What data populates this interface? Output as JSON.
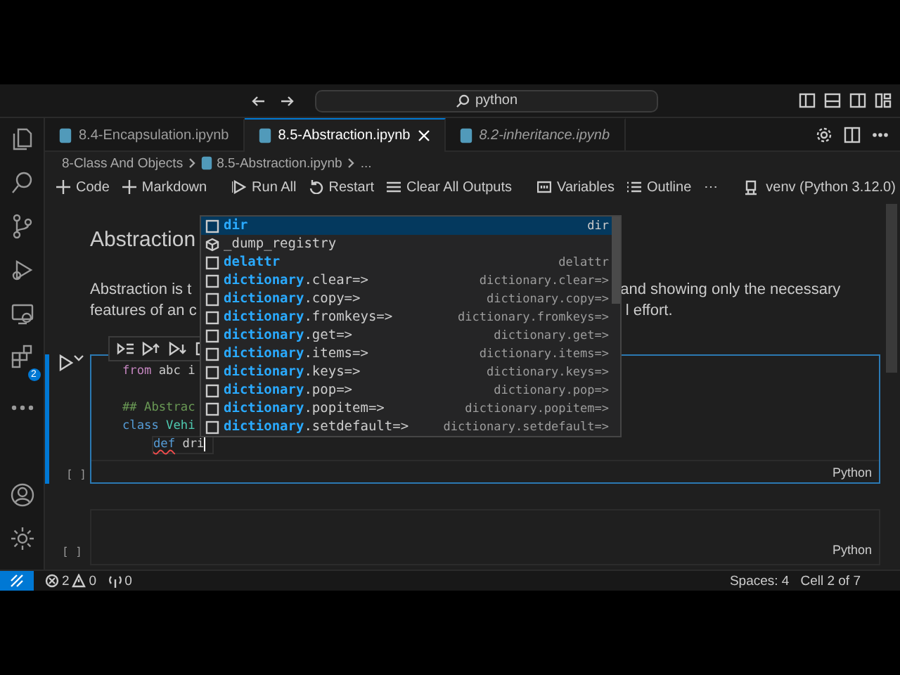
{
  "title_bar": {
    "search": "python"
  },
  "activity_bar": {
    "extensions_badge": "2"
  },
  "tabs": [
    {
      "label": "8.4-Encapsulation.ipynb",
      "selected": false,
      "preview": false
    },
    {
      "label": "8.5-Abstraction.ipynb",
      "selected": true,
      "preview": false
    },
    {
      "label": "8.2-inheritance.ipynb",
      "selected": false,
      "preview": true
    }
  ],
  "breadcrumb": [
    "8-Class And Objects",
    "8.5-Abstraction.ipynb",
    "..."
  ],
  "toolbar": {
    "items": [
      {
        "kind": "add",
        "label": "Code"
      },
      {
        "kind": "add",
        "label": "Markdown"
      },
      {
        "kind": "separator"
      },
      {
        "kind": "run",
        "label": "Run All"
      },
      {
        "kind": "restart",
        "label": "Restart"
      },
      {
        "kind": "clear",
        "label": "Clear All Outputs"
      },
      {
        "kind": "separator"
      },
      {
        "kind": "variables",
        "label": "Variables"
      },
      {
        "kind": "outline",
        "label": "Outline"
      },
      {
        "kind": "more",
        "label": "⋯"
      }
    ],
    "kernel": "venv (Python 3.12.0)"
  },
  "notebook": {
    "heading": "Abstraction",
    "paragraph_lines": [
      {
        "left": "Abstraction is t",
        "right": "and showing only the necessary"
      },
      {
        "left": "features of an c",
        "right": "l effort."
      }
    ],
    "code_cell": {
      "execution": "[ ]",
      "language": "Python",
      "lines": [
        {
          "kind": "code",
          "tokens": [
            {
              "text": "from",
              "kind": "import"
            },
            {
              "text": " abc i",
              "kind": "plain"
            }
          ]
        },
        {
          "kind": "blank"
        },
        {
          "kind": "code",
          "tokens": [
            {
              "text": "## Abstrac",
              "kind": "comment"
            }
          ]
        },
        {
          "kind": "code",
          "tokens": [
            {
              "text": "class",
              "kind": "keyword"
            },
            {
              "text": " Vehi",
              "kind": "name"
            }
          ]
        },
        {
          "kind": "code",
          "indent": true,
          "current": true,
          "tokens": [
            {
              "text": "def",
              "kind": "keyword",
              "error": true
            },
            {
              "text": " dri",
              "kind": "plain"
            }
          ]
        }
      ]
    },
    "empty_cell": {
      "execution": "[ ]",
      "language": "Python"
    }
  },
  "suggestions": [
    {
      "kind": "variable",
      "match": "dir",
      "detail": "dir",
      "selected": true
    },
    {
      "kind": "module",
      "rest": "_dump_registry",
      "selected": false
    },
    {
      "kind": "variable",
      "match": "delattr",
      "detail": "delattr",
      "selected": false
    },
    {
      "kind": "variable",
      "match": "dictionary",
      "rest": ".clear=>",
      "detail": "dictionary.clear=>",
      "selected": false
    },
    {
      "kind": "variable",
      "match": "dictionary",
      "rest": ".copy=>",
      "detail": "dictionary.copy=>",
      "selected": false
    },
    {
      "kind": "variable",
      "match": "dictionary",
      "rest": ".fromkeys=>",
      "detail": "dictionary.fromkeys=>",
      "selected": false
    },
    {
      "kind": "variable",
      "match": "dictionary",
      "rest": ".get=>",
      "detail": "dictionary.get=>",
      "selected": false
    },
    {
      "kind": "variable",
      "match": "dictionary",
      "rest": ".items=>",
      "detail": "dictionary.items=>",
      "selected": false
    },
    {
      "kind": "variable",
      "match": "dictionary",
      "rest": ".keys=>",
      "detail": "dictionary.keys=>",
      "selected": false
    },
    {
      "kind": "variable",
      "match": "dictionary",
      "rest": ".pop=>",
      "detail": "dictionary.pop=>",
      "selected": false
    },
    {
      "kind": "variable",
      "match": "dictionary",
      "rest": ".popitem=>",
      "detail": "dictionary.popitem=>",
      "selected": false
    },
    {
      "kind": "variable",
      "match": "dictionary",
      "rest": ".setdefault=>",
      "detail": "dictionary.setdefault=>",
      "selected": false
    }
  ],
  "status_bar": {
    "errors": "2",
    "warnings": "0",
    "ports": "0",
    "spaces": "Spaces: 4",
    "cell": "Cell 2 of 7"
  }
}
